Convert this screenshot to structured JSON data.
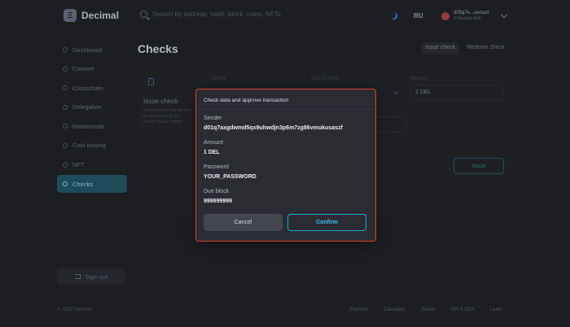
{
  "header": {
    "app_name": "Decimal",
    "logo_letter": "Ξ",
    "search_placeholder": "Search by address, hash, block, coins, NFTs",
    "language": "RU",
    "account_address": "d05q7e...uwsazf",
    "account_balance": "0 Decimal (dol)"
  },
  "sidebar": {
    "items": [
      {
        "label": "Dashboard",
        "active": false
      },
      {
        "label": "Convert",
        "active": false
      },
      {
        "label": "Crosschain",
        "active": false
      },
      {
        "label": "Delegation",
        "active": false
      },
      {
        "label": "Masternode",
        "active": false
      },
      {
        "label": "Coin issuing",
        "active": false
      },
      {
        "label": "NFT",
        "active": false
      },
      {
        "label": "Checks",
        "active": true
      }
    ],
    "signout_label": "Sign out"
  },
  "page": {
    "title": "Checks",
    "tab_issue": "Issue check",
    "tab_redeem": "Redeem check",
    "issue_title": "Issue check",
    "issue_description": "Issue a check that will only be redeemed by the person of your choice",
    "label_nonce": "Nonce",
    "label_coin": "Coin to send",
    "label_amount": "Amount",
    "amount_value": "1 DEL",
    "issue_button": "Issue"
  },
  "modal": {
    "title": "Check data and approve transaction",
    "fields": [
      {
        "label": "Sender",
        "value": "d01q7axgdwmd5qx9uhwdjn3p6m7zg86vmukusaszf"
      },
      {
        "label": "Amount",
        "value": "1 DEL"
      },
      {
        "label": "Password",
        "value": "YOUR_PASSWORD"
      },
      {
        "label": "Due block",
        "value": "999999999"
      }
    ],
    "cancel_label": "Cancel",
    "confirm_label": "Confirm"
  },
  "footer": {
    "copyright": "© 2023 Decimal",
    "links": [
      "Explorer",
      "Calculator",
      "Status",
      "API & SDK",
      "Learn"
    ]
  },
  "colors": {
    "background": "#1c1e22",
    "modal_bg": "#2a2c32",
    "modal_highlight": "#d8432f",
    "confirm_accent": "#18a9d9",
    "active_nav": "#1f4a5a"
  }
}
